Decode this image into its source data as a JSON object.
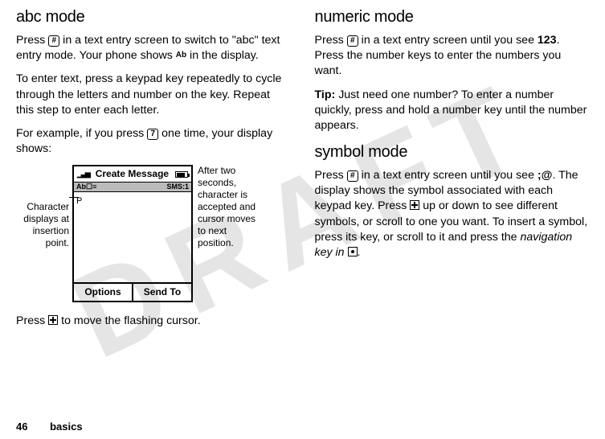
{
  "watermark": "DRAFT",
  "left": {
    "heading": "abc mode",
    "p1a": "Press ",
    "p1key": "#",
    "p1b": " in a text entry screen to switch to \"abc\" text entry mode. Your phone shows ",
    "p1ind": "Ab",
    "p1c": " in the display.",
    "p2": "To enter text, press a keypad key repeatedly to cycle through the letters and number on the key. Repeat this step to enter each letter.",
    "p3a": "For example, if you press ",
    "p3key": "7",
    "p3b": " one time, your display shows:",
    "annoL": "Character displays at insertion point.",
    "annoR": "After two seconds, character is accepted and cursor moves to next position.",
    "phone": {
      "title": "Create Message",
      "statusL": "Ab☐≡",
      "statusR": "SMS:1",
      "bodyChar": "P",
      "softL": "Options",
      "softR": "Send To"
    },
    "p4a": "Press ",
    "p4b": " to move the flashing cursor."
  },
  "right": {
    "h1": "numeric mode",
    "r1a": "Press ",
    "r1key": "#",
    "r1b": " in a text entry screen until you see ",
    "r1ind": "123",
    "r1c": ". Press the number keys to enter the numbers you want.",
    "r2tip": "Tip:",
    "r2": " Just need one number? To enter a number quickly, press and hold a number key until the number appears.",
    "h2": "symbol mode",
    "r3a": "Press ",
    "r3key": "#",
    "r3b": " in a text entry screen until you see ",
    "r3ind": ";@",
    "r3c": ". The display shows the symbol associated with each keypad key. Press ",
    "r3d": " up or down to see different symbols, or scroll to one you want. To insert a symbol, press its key, or scroll to it and press the ",
    "r3e": "navigation key in",
    "r3f": " ",
    "r3g": "."
  },
  "footer": {
    "page": "46",
    "section": "basics"
  }
}
